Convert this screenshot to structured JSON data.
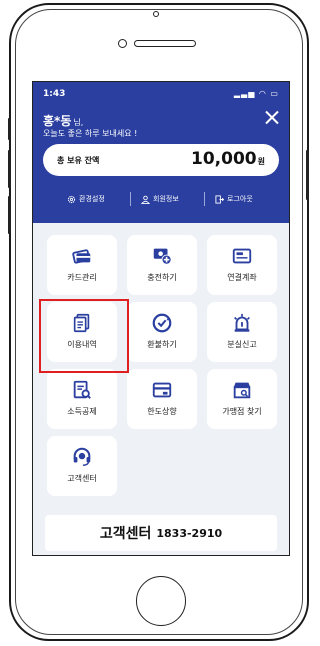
{
  "status": {
    "time": "1:43",
    "icons": "▂▃▅ ◠ ▭"
  },
  "greeting": {
    "name": "홍*동",
    "honorific": "님,",
    "message": "오늘도 좋은 하루 보내세요 !"
  },
  "balance": {
    "label": "총 보유 잔액",
    "amount": "10,000",
    "unit": "원"
  },
  "menu": [
    {
      "label": "환경설정",
      "icon": "gear-icon"
    },
    {
      "label": "회원정보",
      "icon": "user-icon"
    },
    {
      "label": "로그아웃",
      "icon": "logout-icon"
    }
  ],
  "tiles": [
    {
      "label": "카드관리",
      "icon": "card-icon"
    },
    {
      "label": "충전하기",
      "icon": "charge-icon"
    },
    {
      "label": "연결계좌",
      "icon": "account-icon"
    },
    {
      "label": "이용내역",
      "icon": "history-icon"
    },
    {
      "label": "환불하기",
      "icon": "refund-icon"
    },
    {
      "label": "분실신고",
      "icon": "alarm-icon"
    },
    {
      "label": "소득공제",
      "icon": "tax-icon"
    },
    {
      "label": "한도상향",
      "icon": "limit-icon"
    },
    {
      "label": "가맹점 찾기",
      "icon": "store-icon"
    },
    {
      "label": "고객센터",
      "icon": "headset-icon"
    }
  ],
  "footer": {
    "title": "고객센터",
    "phone": "1833-2910"
  },
  "colors": {
    "header": "#2a3fa0",
    "icon_blue": "#2a3fa0",
    "highlight": "#e02020"
  }
}
